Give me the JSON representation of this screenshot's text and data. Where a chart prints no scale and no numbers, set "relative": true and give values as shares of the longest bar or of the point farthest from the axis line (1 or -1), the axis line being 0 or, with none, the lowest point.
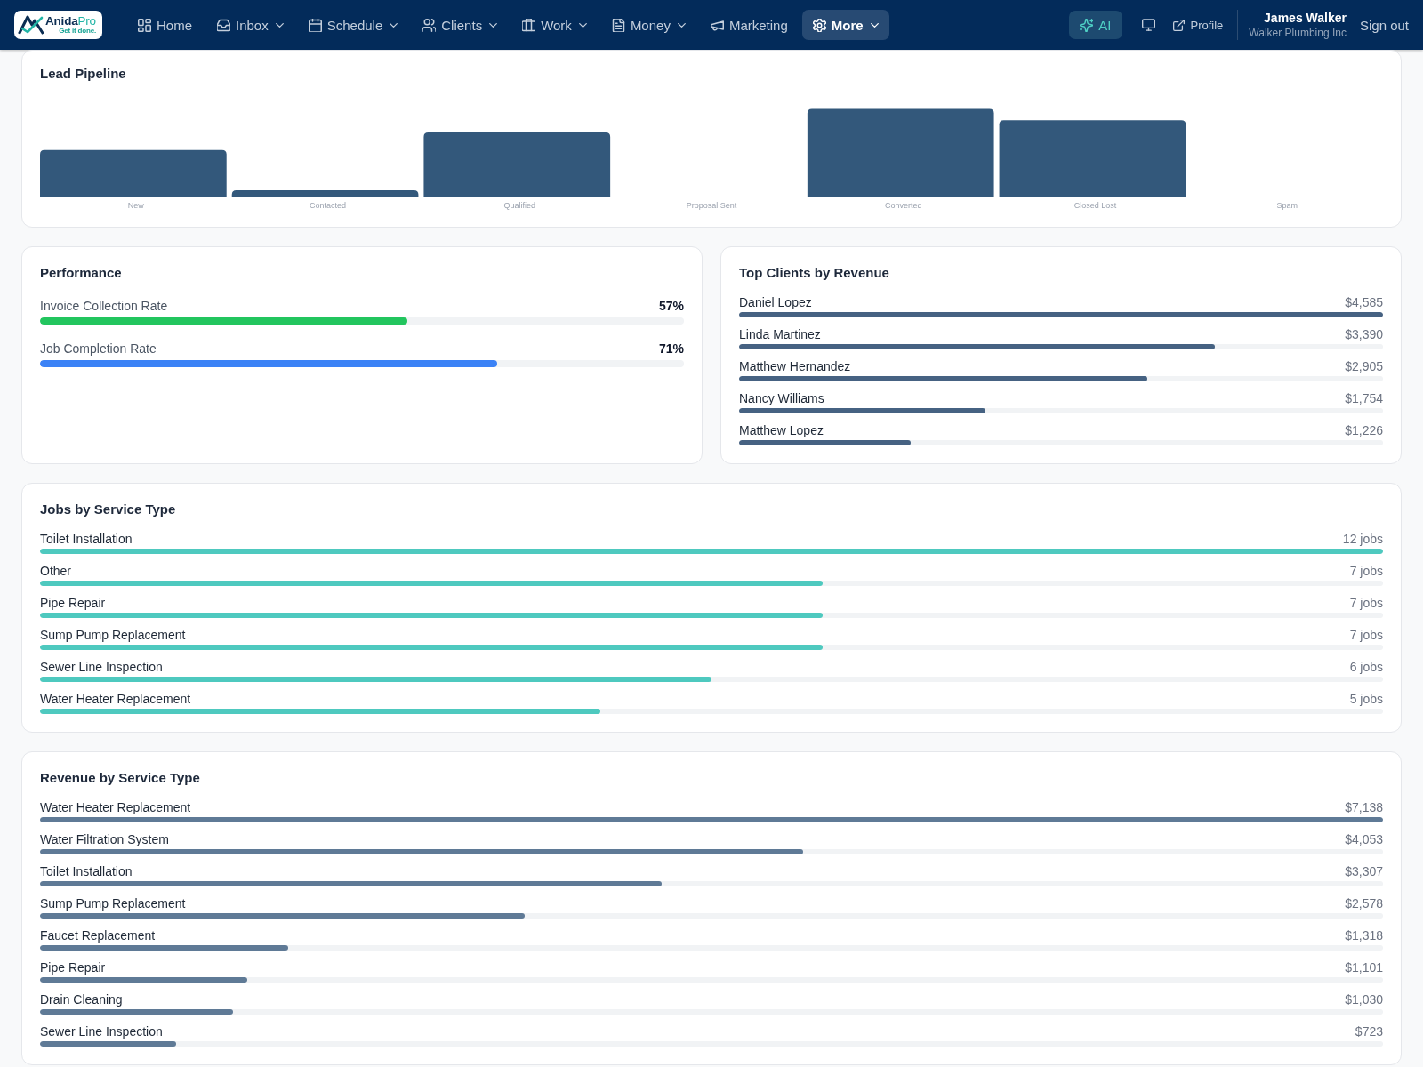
{
  "brand": {
    "name": "Anida",
    "name_suffix": "Pro",
    "tagline": "Get it done."
  },
  "nav": [
    {
      "label": "Home",
      "has_menu": false,
      "selected": false
    },
    {
      "label": "Inbox",
      "has_menu": true,
      "selected": false
    },
    {
      "label": "Schedule",
      "has_menu": true,
      "selected": false
    },
    {
      "label": "Clients",
      "has_menu": true,
      "selected": false
    },
    {
      "label": "Work",
      "has_menu": true,
      "selected": false
    },
    {
      "label": "Money",
      "has_menu": true,
      "selected": false
    },
    {
      "label": "Marketing",
      "has_menu": false,
      "selected": false
    },
    {
      "label": "More",
      "has_menu": true,
      "selected": true
    }
  ],
  "ai_button": {
    "label": "AI"
  },
  "profile_link": {
    "label": "Profile"
  },
  "user": {
    "name": "James Walker",
    "company": "Walker Plumbing Inc"
  },
  "sign_out": {
    "label": "Sign out"
  },
  "lead_pipeline": {
    "title": "Lead Pipeline",
    "chart_data": {
      "type": "bar",
      "relative": true,
      "categories": [
        "New",
        "Contacted",
        "Qualified",
        "Proposal Sent",
        "Converted",
        "Closed Lost",
        "Spam"
      ],
      "values": [
        0.53,
        0.07,
        0.73,
        0,
        1,
        0.87,
        0
      ]
    }
  },
  "performance": {
    "title": "Performance",
    "metrics": [
      {
        "label": "Invoice Collection Rate",
        "value": "57%",
        "level": 0.57,
        "color": "#22c55e"
      },
      {
        "label": "Job Completion Rate",
        "value": "71%",
        "level": 0.71,
        "color": "#3b82f6"
      }
    ]
  },
  "top_clients": {
    "title": "Top Clients by Revenue",
    "rows": [
      {
        "name": "Daniel Lopez",
        "amount": "$4,585",
        "level": 1.0
      },
      {
        "name": "Linda Martinez",
        "amount": "$3,390",
        "level": 0.739
      },
      {
        "name": "Matthew Hernandez",
        "amount": "$2,905",
        "level": 0.634
      },
      {
        "name": "Nancy Williams",
        "amount": "$1,754",
        "level": 0.383
      },
      {
        "name": "Matthew Lopez",
        "amount": "$1,226",
        "level": 0.267
      }
    ]
  },
  "jobs_by_service": {
    "title": "Jobs by Service Type",
    "rows": [
      {
        "name": "Toilet Installation",
        "count": "12 jobs",
        "level": 1.0
      },
      {
        "name": "Other",
        "count": "7 jobs",
        "level": 0.583
      },
      {
        "name": "Pipe Repair",
        "count": "7 jobs",
        "level": 0.583
      },
      {
        "name": "Sump Pump Replacement",
        "count": "7 jobs",
        "level": 0.583
      },
      {
        "name": "Sewer Line Inspection",
        "count": "6 jobs",
        "level": 0.5
      },
      {
        "name": "Water Heater Replacement",
        "count": "5 jobs",
        "level": 0.417
      }
    ]
  },
  "revenue_by_service": {
    "title": "Revenue by Service Type",
    "rows": [
      {
        "name": "Water Heater Replacement",
        "amount": "$7,138",
        "level": 1.0
      },
      {
        "name": "Water Filtration System",
        "amount": "$4,053",
        "level": 0.568
      },
      {
        "name": "Toilet Installation",
        "amount": "$3,307",
        "level": 0.463
      },
      {
        "name": "Sump Pump Replacement",
        "amount": "$2,578",
        "level": 0.361
      },
      {
        "name": "Faucet Replacement",
        "amount": "$1,318",
        "level": 0.185
      },
      {
        "name": "Pipe Repair",
        "amount": "$1,101",
        "level": 0.154
      },
      {
        "name": "Drain Cleaning",
        "amount": "$1,030",
        "level": 0.144
      },
      {
        "name": "Sewer Line Inspection",
        "amount": "$723",
        "level": 0.101
      }
    ]
  }
}
